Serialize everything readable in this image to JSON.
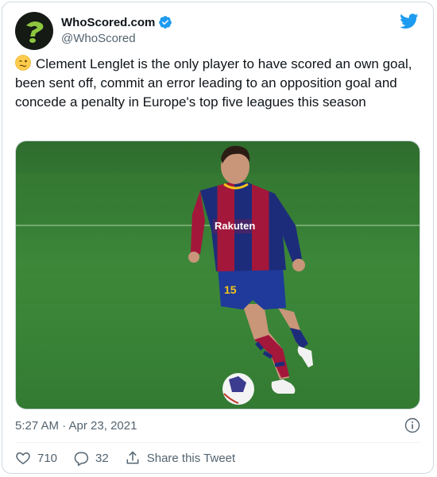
{
  "tweet": {
    "author": {
      "display_name": "WhoScored.com",
      "handle": "@WhoScored",
      "verified": true,
      "avatar_icon": "whoscored-logo-icon",
      "avatar_bg": "#151a15",
      "avatar_accent": "#8dc63f"
    },
    "brand_icon": "twitter-bird-icon",
    "brand_color": "#1d9bf0",
    "emoji": "woozy-face-emoji",
    "text": "Clement Lenglet is the only player to have scored an own goal, been sent off, commit an error leading to an opposition goal and concede a penalty in Europe's top five leagues this season",
    "media": {
      "kit_sponsor": "Rakuten",
      "shirt_number": "15"
    },
    "timestamp": "5:27 AM · Apr 23, 2021",
    "actions": {
      "likes": "710",
      "replies": "32",
      "share_label": "Share this Tweet"
    },
    "colors": {
      "text_primary": "#0f1419",
      "text_secondary": "#536471",
      "border": "#cfd9de",
      "pitch": "#3f8a3b"
    }
  }
}
